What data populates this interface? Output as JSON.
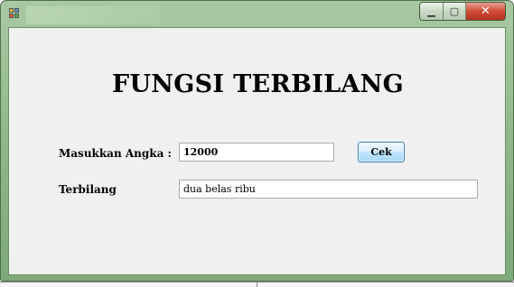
{
  "window": {
    "title": "",
    "minimize_glyph": "▁",
    "maximize_glyph": "▢",
    "close_glyph": "✕"
  },
  "form": {
    "title": "FUNGSI TERBILANG",
    "angka_label": "Masukkan Angka :",
    "angka_value": "12000",
    "cek_button": "Cek",
    "terbilang_label": "Terbilang",
    "terbilang_value": "dua belas ribu"
  },
  "colors": {
    "frame": "#8fb889",
    "client": "#f0f0f0",
    "close_button": "#cf4b37",
    "button_border": "#3c7fb1"
  }
}
